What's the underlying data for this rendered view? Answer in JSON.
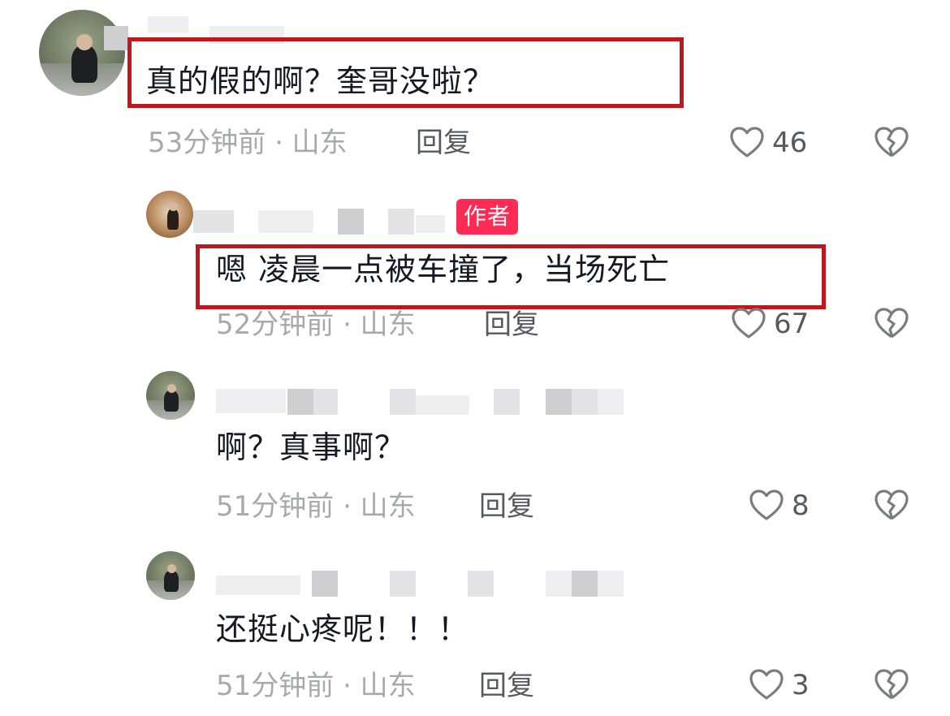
{
  "comments": [
    {
      "text": "真的假的啊？奎哥没啦？",
      "time_location": "53分钟前 · 山东",
      "reply_label": "回复",
      "likes": "46",
      "highlighted": true
    },
    {
      "author_badge": "作者",
      "text": "嗯 凌晨一点被车撞了，当场死亡",
      "time_location": "52分钟前 · 山东",
      "reply_label": "回复",
      "likes": "67",
      "highlighted": true
    },
    {
      "text": "啊？真事啊？",
      "time_location": "51分钟前 · 山东",
      "reply_label": "回复",
      "likes": "8",
      "highlighted": false
    },
    {
      "text": "还挺心疼呢！！！",
      "time_location": "51分钟前 · 山东",
      "reply_label": "回复",
      "likes": "3",
      "highlighted": false
    }
  ],
  "colors": {
    "highlight_border": "#c0171c",
    "author_badge_bg": "#fe2c55",
    "text_primary": "#161823",
    "text_meta": "#a8a9ad",
    "text_reply": "#58595f"
  },
  "icons": {
    "like": "heart-outline-icon",
    "dislike": "broken-heart-icon"
  }
}
